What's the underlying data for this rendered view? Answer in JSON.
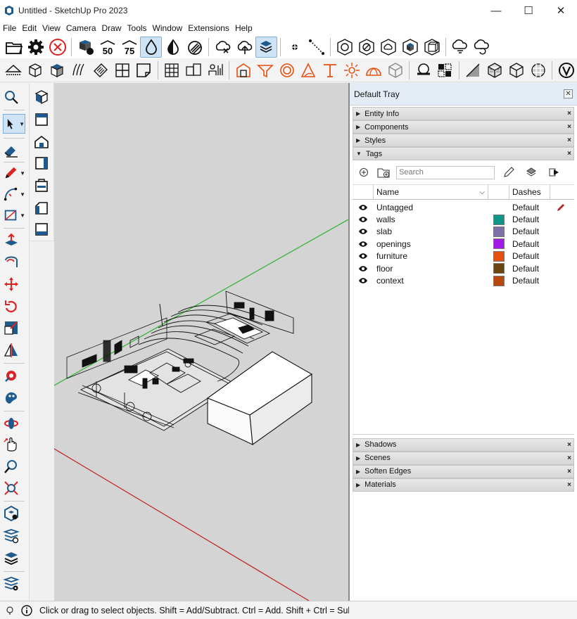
{
  "window": {
    "title": "Untitled - SketchUp Pro 2023",
    "minimize": "—",
    "maximize": "☐",
    "close": "✕"
  },
  "menu": [
    "File",
    "Edit",
    "View",
    "Camera",
    "Draw",
    "Tools",
    "Window",
    "Extensions",
    "Help"
  ],
  "toolbar1": {
    "icons": [
      "open-folder",
      "settings",
      "cancel",
      "components-3d",
      "section-50",
      "section-75",
      "drop-outline",
      "drop-half",
      "drop-striped",
      "cloud-x",
      "cloud-upload",
      "layers-upload",
      "dot",
      "dashed-line",
      "reset-hex",
      "no-hex",
      "cloud-hex",
      "box-hex",
      "cube-hex",
      "cloud-sync",
      "cloud-refresh"
    ],
    "labels": [
      "50",
      "75"
    ]
  },
  "toolbar2": {
    "icons": [
      "tape",
      "box-wire",
      "box-solid",
      "sandbox",
      "stamp",
      "grid-2",
      "fold",
      "grid-3",
      "scale",
      "stats",
      "warehouse",
      "funnel",
      "ring",
      "protractor",
      "t-bar",
      "starburst",
      "dome",
      "hex-box",
      "sphere",
      "puzzle",
      "checker",
      "cube-check",
      "cube-grid",
      "sphere-check",
      "v-logo"
    ]
  },
  "left_tools": [
    "search-icon",
    "select-arrow",
    "eraser",
    "pencil",
    "arc",
    "rectangle",
    "push-pull",
    "follow-me",
    "move",
    "rotate",
    "scale",
    "flip",
    "paint",
    "sample",
    "orbit",
    "pan",
    "zoom",
    "zoom-extents",
    "component-hex",
    "layers-tag",
    "layers-stack",
    "layers-gear"
  ],
  "left_tools2": [
    "iso-view",
    "top-view",
    "front-view",
    "right-view",
    "back-view",
    "left-view",
    "bottom-view"
  ],
  "tray": {
    "title": "Default Tray",
    "panels_top": [
      "Entity Info",
      "Components",
      "Styles",
      "Tags"
    ],
    "panels_bottom": [
      "Shadows",
      "Scenes",
      "Soften Edges",
      "Materials"
    ],
    "search_placeholder": "Search",
    "tags_columns": {
      "name": "Name",
      "dashes": "Dashes"
    },
    "tags": [
      {
        "name": "Untagged",
        "dashes": "Default",
        "color": null
      },
      {
        "name": "walls",
        "dashes": "Default",
        "color": "#0e9688"
      },
      {
        "name": "slab",
        "dashes": "Default",
        "color": "#7f6fa8"
      },
      {
        "name": "openings",
        "dashes": "Default",
        "color": "#a319e6"
      },
      {
        "name": "furniture",
        "dashes": "Default",
        "color": "#e5500f"
      },
      {
        "name": "floor",
        "dashes": "Default",
        "color": "#6a4510"
      },
      {
        "name": "context",
        "dashes": "Default",
        "color": "#b9480f"
      }
    ]
  },
  "status": "Click or drag to select objects. Shift = Add/Subtract. Ctrl = Add. Shift + Ctrl = Subtract."
}
